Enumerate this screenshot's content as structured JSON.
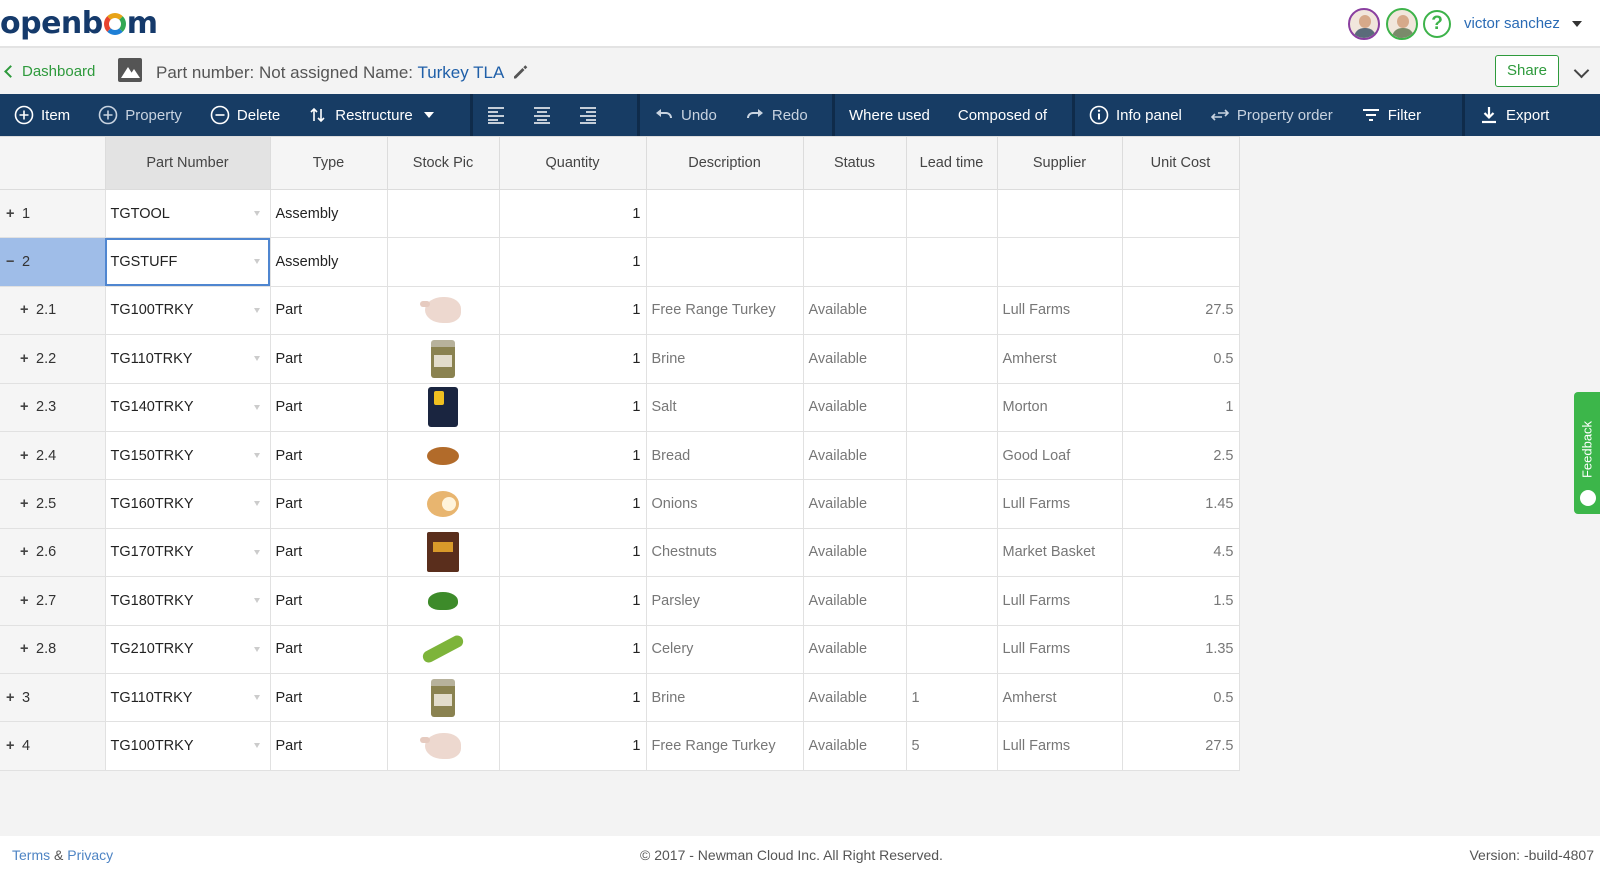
{
  "header": {
    "logo": "openbom",
    "user_name": "victor sanchez"
  },
  "subheader": {
    "back_label": "Dashboard",
    "part_number_label": "Part number: Not assigned Name:",
    "part_name": "Turkey TLA",
    "share_label": "Share"
  },
  "toolbar": {
    "item": "Item",
    "property": "Property",
    "delete": "Delete",
    "restructure": "Restructure",
    "undo": "Undo",
    "redo": "Redo",
    "where_used": "Where used",
    "composed_of": "Composed of",
    "info_panel": "Info panel",
    "property_order": "Property order",
    "filter": "Filter",
    "export": "Export"
  },
  "grid": {
    "columns": [
      "Part Number",
      "Type",
      "Stock Pic",
      "Quantity",
      "Description",
      "Status",
      "Lead time",
      "Supplier",
      "Unit Cost"
    ],
    "rows": [
      {
        "sign": "+",
        "no": "1",
        "part": "TGTOOL",
        "type": "Assembly",
        "pic": "",
        "qty": "1",
        "desc": "",
        "status": "",
        "lead": "",
        "supplier": "",
        "cost": ""
      },
      {
        "sign": "−",
        "no": "2",
        "part": "TGSTUFF",
        "type": "Assembly",
        "pic": "",
        "qty": "1",
        "desc": "",
        "status": "",
        "lead": "",
        "supplier": "",
        "cost": ""
      },
      {
        "sign": "+",
        "no": "2.1",
        "part": "TG100TRKY",
        "type": "Part",
        "pic": "turkey",
        "qty": "1",
        "desc": "Free Range Turkey",
        "status": "Available",
        "lead": "",
        "supplier": "Lull Farms",
        "cost": "27.5"
      },
      {
        "sign": "+",
        "no": "2.2",
        "part": "TG110TRKY",
        "type": "Part",
        "pic": "jar",
        "qty": "1",
        "desc": "Brine",
        "status": "Available",
        "lead": "",
        "supplier": "Amherst",
        "cost": "0.5"
      },
      {
        "sign": "+",
        "no": "2.3",
        "part": "TG140TRKY",
        "type": "Part",
        "pic": "salt",
        "qty": "1",
        "desc": "Salt",
        "status": "Available",
        "lead": "",
        "supplier": "Morton",
        "cost": "1"
      },
      {
        "sign": "+",
        "no": "2.4",
        "part": "TG150TRKY",
        "type": "Part",
        "pic": "bread",
        "qty": "1",
        "desc": "Bread",
        "status": "Available",
        "lead": "",
        "supplier": "Good Loaf",
        "cost": "2.5"
      },
      {
        "sign": "+",
        "no": "2.5",
        "part": "TG160TRKY",
        "type": "Part",
        "pic": "onion",
        "qty": "1",
        "desc": "Onions",
        "status": "Available",
        "lead": "",
        "supplier": "Lull Farms",
        "cost": "1.45"
      },
      {
        "sign": "+",
        "no": "2.6",
        "part": "TG170TRKY",
        "type": "Part",
        "pic": "chestnut",
        "qty": "1",
        "desc": "Chestnuts",
        "status": "Available",
        "lead": "",
        "supplier": "Market Basket",
        "cost": "4.5"
      },
      {
        "sign": "+",
        "no": "2.7",
        "part": "TG180TRKY",
        "type": "Part",
        "pic": "parsley",
        "qty": "1",
        "desc": "Parsley",
        "status": "Available",
        "lead": "",
        "supplier": "Lull Farms",
        "cost": "1.5"
      },
      {
        "sign": "+",
        "no": "2.8",
        "part": "TG210TRKY",
        "type": "Part",
        "pic": "celery",
        "qty": "1",
        "desc": "Celery",
        "status": "Available",
        "lead": "",
        "supplier": "Lull Farms",
        "cost": "1.35"
      },
      {
        "sign": "+",
        "no": "3",
        "part": "TG110TRKY",
        "type": "Part",
        "pic": "jar",
        "qty": "1",
        "desc": "Brine",
        "status": "Available",
        "lead": "1",
        "supplier": "Amherst",
        "cost": "0.5"
      },
      {
        "sign": "+",
        "no": "4",
        "part": "TG100TRKY",
        "type": "Part",
        "pic": "turkey",
        "qty": "1",
        "desc": "Free Range Turkey",
        "status": "Available",
        "lead": "5",
        "supplier": "Lull Farms",
        "cost": "27.5"
      }
    ]
  },
  "feedback_label": "Feedback",
  "footer": {
    "terms": "Terms",
    "amp": "&",
    "privacy": "Privacy",
    "copyright": "© 2017 - Newman Cloud Inc. All Right Reserved.",
    "version": "Version: -build-4807"
  }
}
